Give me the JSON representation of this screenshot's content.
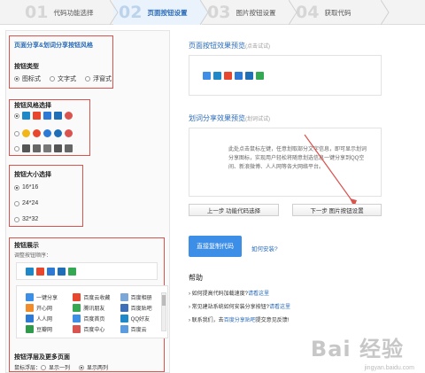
{
  "steps": [
    {
      "num": "01",
      "label": "代码功能选择"
    },
    {
      "num": "02",
      "label": "页面按钮设置"
    },
    {
      "num": "03",
      "label": "图片按钮设置"
    },
    {
      "num": "04",
      "label": "获取代码"
    }
  ],
  "left": {
    "section_title": "页面分享&划词分享按钮风格",
    "type_label": "按钮类型",
    "type_options": [
      "图标式",
      "文字式",
      "浮窗式"
    ],
    "style_label": "按钮风格选择",
    "size_label": "按钮大小选择",
    "size_options": [
      "16*16",
      "24*24",
      "32*32"
    ],
    "display_label": "按钮展示",
    "display_hint": "调整按钮顺序：",
    "list": [
      [
        "一键分享",
        "百度云收藏",
        "百度相册"
      ],
      [
        "开心网",
        "腾讯朋友",
        "百度贴吧"
      ],
      [
        "人人网",
        "百度首页",
        "QQ好友"
      ],
      [
        "豆瓣网",
        "百度中心",
        "百度云"
      ]
    ],
    "float_label": "按钮浮层及更多页面",
    "float_row_label": "鼠标浮层：",
    "float_options": [
      "显示一列",
      "显示两列"
    ]
  },
  "right": {
    "preview_title": "页面按钮效果预览",
    "preview_hint": "(点击试试)",
    "hw_title": "划词分享效果预览",
    "hw_hint": "(划词试试)",
    "hw_text": "此处点击鼠标左键，任意划取部分文字信息，即可显示划词分享图标，实现用户轻松将随意划选信息一键分享到QQ空间、新浪微博、人人网等各大网络平台。",
    "prev_btn": "上一步 功能代码选择",
    "next_btn": "下一步 图片按钮设置",
    "copy_btn": "直接复制代码",
    "install_link": "如何安装?",
    "help_title": "帮助",
    "help_items": [
      {
        "text": "如何提高代码加载速度?",
        "link": "请看这里"
      },
      {
        "text": "常见建站系统如何安装分享按钮?",
        "link": "请看这里"
      },
      {
        "text": "联系我们，去",
        "link": "百度分享贴吧",
        "tail": "提交意见反馈!"
      }
    ]
  },
  "watermark": "Bai 经验",
  "watermark_sub": "jingyan.baidu.com",
  "colors": {
    "accent": "#2a6cb8",
    "highlight": "#d9534f",
    "primary_button": "#3d8ee6"
  }
}
